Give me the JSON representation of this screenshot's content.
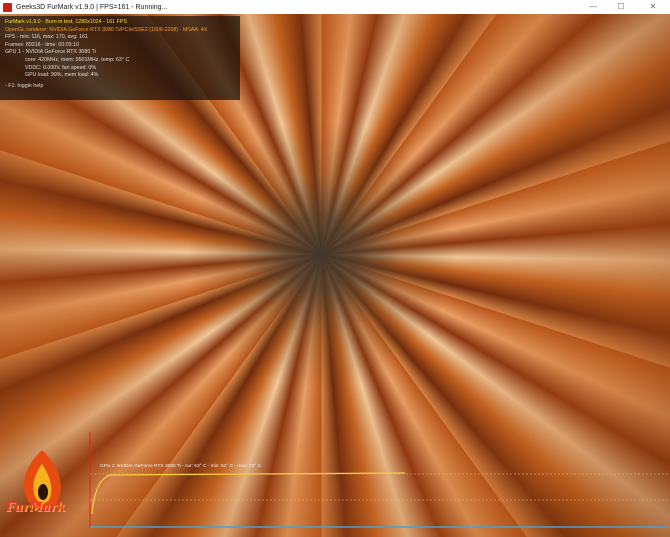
{
  "window": {
    "title": "Geeks3D FurMark v1.9.0 | FPS=161 - Running...",
    "minimize": "—",
    "maximize": "☐",
    "close": "✕"
  },
  "hud": {
    "line1": "FurMark v1.9.0 - Burn-in test, 1280x1024 - 161 FPS",
    "line2": "OpenGL renderer: NVIDIA GeForce RTX 3080 Ti/PCIe/SSE2 (1006-2208) - MSAA: 4X",
    "line3": "FPS - min: 116, max: 170, avg: 161",
    "line4": "Frames: 89316 - time: 00:09:10",
    "line5": "GPU 1 - NVIDIA GeForce RTX 3080 Ti",
    "line6": "core: 420MHz, mem: 9501MHz, temp: 63° C",
    "line7": "VDDC: 0.000V, fan speed: 0%",
    "line8": "GPU load: 99%, mem load: 4%",
    "help": "- F1: toggle help"
  },
  "graph": {
    "label": "GPU 1: NVIDIA GeForce RTX 3080 Ti - cur: 63° C - min: 62° C - max: 70° C"
  },
  "logo": {
    "text": "FurMark"
  }
}
